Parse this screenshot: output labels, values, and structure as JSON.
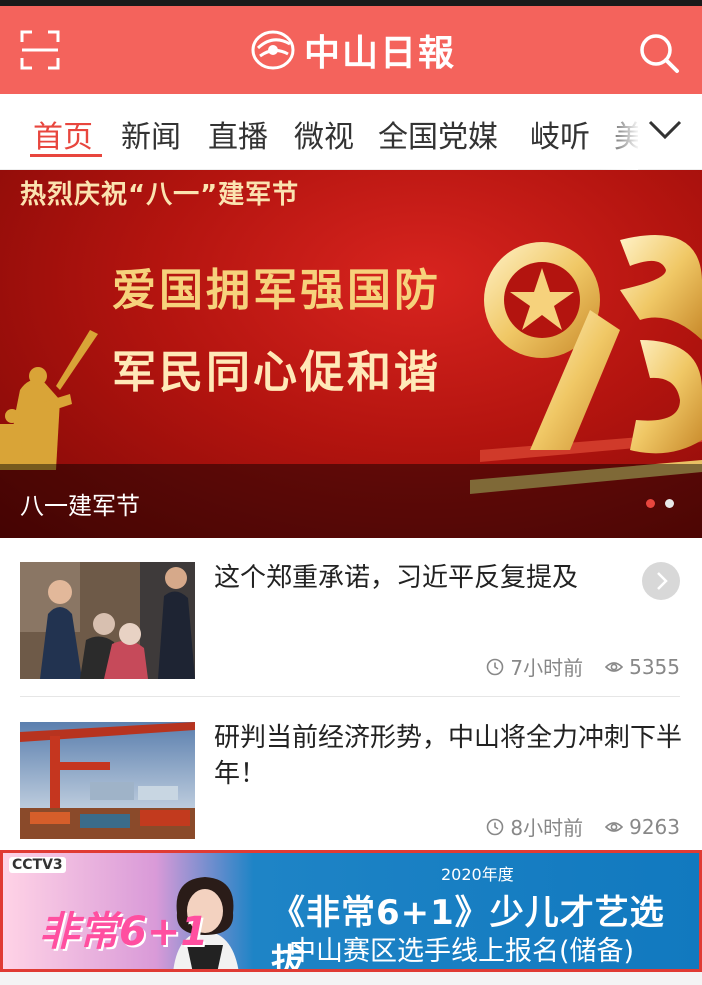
{
  "colors": {
    "brand_red": "#f4635c",
    "active_tab": "#e8463e",
    "ad_border": "#e03b34"
  },
  "header": {
    "scan_icon": "scan-icon",
    "logo_text": "中山日報",
    "search_icon": "search-icon"
  },
  "tabs": {
    "items": [
      {
        "label": "首页",
        "active": true
      },
      {
        "label": "新闻",
        "active": false
      },
      {
        "label": "直播",
        "active": false
      },
      {
        "label": "微视",
        "active": false
      },
      {
        "label": "全国党媒",
        "active": false
      },
      {
        "label": "岐听",
        "active": false
      },
      {
        "label": "美",
        "active": false
      }
    ],
    "more_icon": "chevron-down-icon"
  },
  "banner": {
    "top_text": "热烈庆祝“八一”建军节",
    "line1": "爱国拥军强国防",
    "line2": "军民同心促和谐",
    "number": "93",
    "caption": "八一建军节",
    "current_slide": 1,
    "total_slides": 2
  },
  "news": [
    {
      "title": "这个郑重承诺，习近平反复提及",
      "time": "7小时前",
      "views": "5355"
    },
    {
      "title": "研判当前经济形势，中山将全力冲刺下半年！",
      "time": "8小时前",
      "views": "9263"
    }
  ],
  "ad": {
    "channel": "CCTV3",
    "brand": "非常6+1",
    "year": "2020年度",
    "line1": "《非常6+1》少儿才艺选拔",
    "line2": "中山赛区选手线上报名(储备)"
  }
}
